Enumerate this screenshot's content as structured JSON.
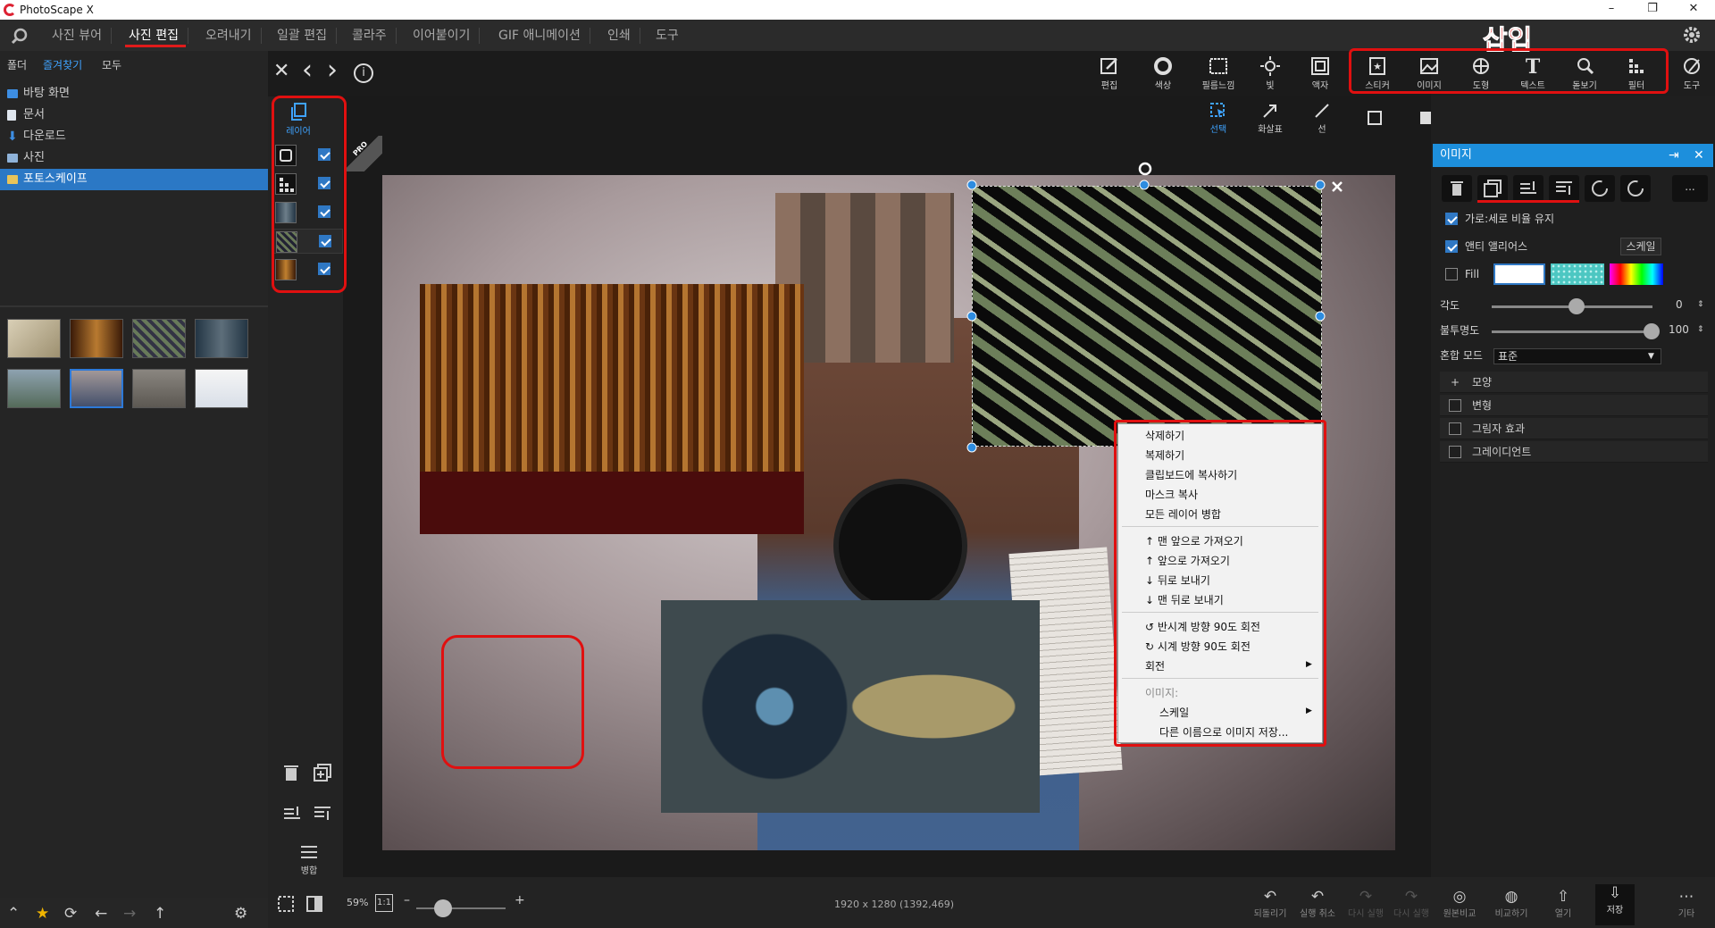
{
  "app": {
    "title": "PhotoScape X"
  },
  "window": {
    "min": "–",
    "max": "❐",
    "close": "✕"
  },
  "menu": {
    "items": [
      "사진 뷰어",
      "사진 편집",
      "오려내기",
      "일괄 편집",
      "콜라주",
      "이어붙이기",
      "GIF 애니메이션",
      "인쇄",
      "도구"
    ],
    "active_index": 1
  },
  "annotation": {
    "insert_label": "삽입",
    "accent": "#e01010"
  },
  "left": {
    "tabs": [
      "폴더",
      "즐겨찾기",
      "모두"
    ],
    "active_tab": 1,
    "tree": [
      "바탕 화면",
      "문서",
      "다운로드",
      "사진",
      "포토스케이프"
    ],
    "selected_tree": 4
  },
  "nav": {
    "close": "✕",
    "prev": "‹",
    "next": "›",
    "info": "i"
  },
  "toolbar": {
    "edit": [
      "편집",
      "색상",
      "필름느낌",
      "빛",
      "액자"
    ],
    "insert": [
      "스티커",
      "이미지",
      "도형",
      "텍스트",
      "돋보기",
      "필터"
    ],
    "tools": "도구",
    "sub": [
      "선택",
      "화살표",
      "선"
    ]
  },
  "layers": {
    "label": "레이어",
    "merge": "병합",
    "count": 5
  },
  "pro": "PRO",
  "right": {
    "title": "이미지",
    "keep_ratio": "가로:세로 비율 유지",
    "antialias": "앤티 앨리어스",
    "scale_btn": "스케일",
    "fill": "Fill",
    "angle_label": "각도",
    "angle_value": "0",
    "opacity_label": "불투명도",
    "opacity_value": "100",
    "blend_label": "혼합 모드",
    "blend_value": "표준",
    "sections": [
      "모양",
      "변형",
      "그림자 효과",
      "그레이디언트"
    ],
    "more": "..."
  },
  "context_menu": {
    "items": [
      "삭제하기",
      "복제하기",
      "클립보드에 복사하기",
      "마스크 복사",
      "모든 레이어 병합",
      "↑ 맨 앞으로 가져오기",
      "↑ 앞으로 가져오기",
      "↓ 뒤로 보내기",
      "↓ 맨 뒤로 보내기",
      "↺ 반시계 방향 90도 회전",
      "↻ 시계 방향 90도 회전",
      "회전",
      "이미지:",
      "스케일",
      "다른 이름으로 이미지 저장..."
    ]
  },
  "status": {
    "zoom": "59%",
    "ratio": "1:1",
    "minus": "–",
    "plus": "+",
    "dimensions": "1920 x 1280 (1392,469)",
    "buttons": [
      "되돌리기",
      "실행 취소",
      "다시 실행",
      "다시 실행",
      "원본비교",
      "비교하기",
      "열기",
      "저장",
      "기타"
    ]
  }
}
